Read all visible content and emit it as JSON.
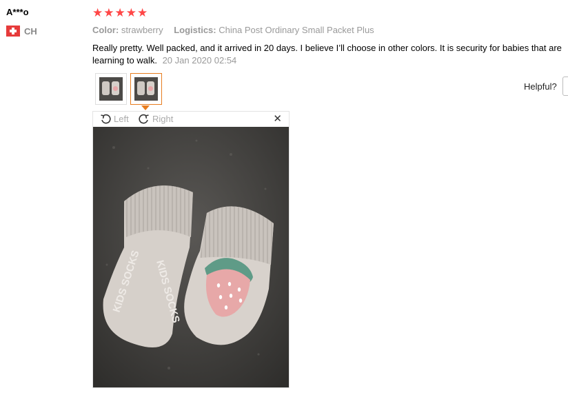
{
  "reviewer": {
    "name": "A***o",
    "country": "CH"
  },
  "rating": {
    "stars": 5,
    "max": 5
  },
  "meta": {
    "color_label": "Color:",
    "color_value": "strawberry",
    "logistics_label": "Logistics:",
    "logistics_value": "China Post Ordinary Small Packet Plus"
  },
  "review": {
    "text": "Really pretty. Well packed, and it arrived in 20 days. I believe I’ll choose in other colors. It is security for babies that are learning to walk.",
    "date": "20 Jan 2020 02:54"
  },
  "helpful_label": "Helpful?",
  "viewer": {
    "rotate_left": "Left",
    "rotate_right": "Right",
    "close": "✕",
    "sock_text_1": "KIDS SOCKS",
    "sock_text_2": "KIDS SOCKS"
  },
  "colors": {
    "accent": "#ff4747",
    "thumb_active": "#e77c1e"
  },
  "icons": [
    "star-icon",
    "rotate-left-icon",
    "rotate-right-icon",
    "close-icon",
    "flag-icon"
  ]
}
